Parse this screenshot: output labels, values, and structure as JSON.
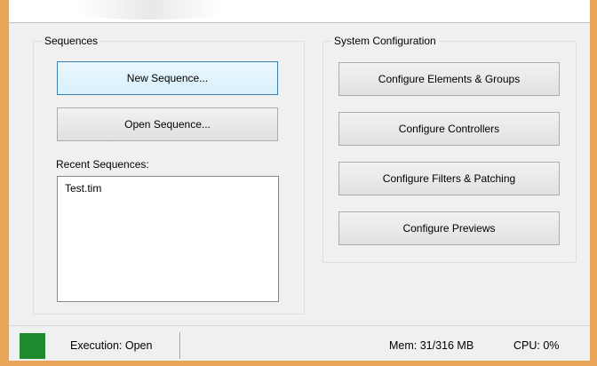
{
  "sequences": {
    "group_label": "Sequences",
    "new_sequence_label": "New Sequence...",
    "open_sequence_label": "Open Sequence...",
    "recent_label": "Recent Sequences:",
    "recent_items": [
      "Test.tim"
    ]
  },
  "system_configuration": {
    "group_label": "System Configuration",
    "buttons": [
      "Configure Elements & Groups",
      "Configure Controllers",
      "Configure Filters & Patching",
      "Configure Previews"
    ]
  },
  "status_bar": {
    "execution_text": "Execution: Open",
    "memory_text": "Mem: 31/316 MB",
    "cpu_text": "CPU: 0%",
    "indicator_color": "#1e8c2e"
  },
  "window": {
    "frame_color": "#e8a557"
  }
}
